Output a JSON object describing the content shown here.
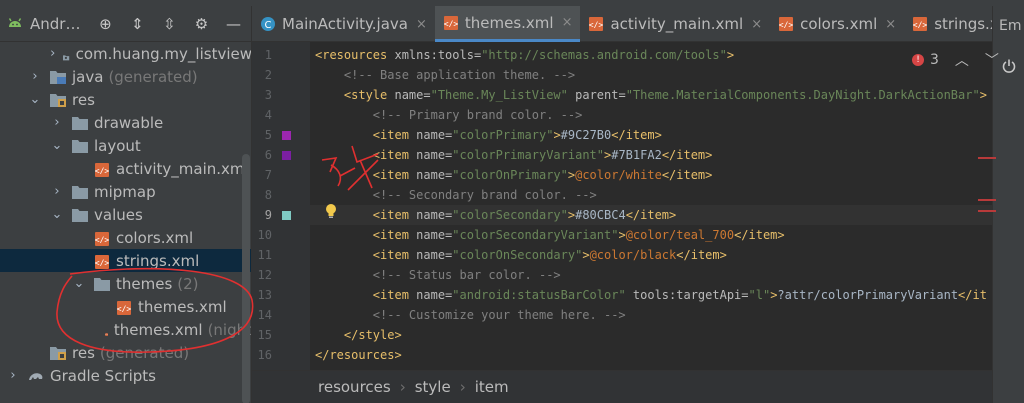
{
  "project_panel": {
    "title": "Andr…",
    "toolbar_icons": [
      "locate-icon",
      "collapse-icon",
      "expand-icon",
      "gear-icon",
      "minimize-icon"
    ]
  },
  "tree": [
    {
      "indent": 1,
      "arrow": "›",
      "icon": "folder-package",
      "label": "com.huang.my_listview",
      "suffix": "",
      "selected": false
    },
    {
      "indent": 0,
      "arrow": "›",
      "icon": "folder-java",
      "label": "java",
      "suffix": "(generated)",
      "selected": false
    },
    {
      "indent": 0,
      "arrow": "⌄",
      "icon": "folder-res",
      "label": "res",
      "suffix": "",
      "selected": false
    },
    {
      "indent": 1,
      "arrow": "›",
      "icon": "folder",
      "label": "drawable",
      "suffix": "",
      "selected": false
    },
    {
      "indent": 1,
      "arrow": "⌄",
      "icon": "folder",
      "label": "layout",
      "suffix": "",
      "selected": false
    },
    {
      "indent": 2,
      "arrow": "",
      "icon": "xml",
      "label": "activity_main.xml",
      "suffix": "",
      "selected": false
    },
    {
      "indent": 1,
      "arrow": "›",
      "icon": "folder",
      "label": "mipmap",
      "suffix": "",
      "selected": false
    },
    {
      "indent": 1,
      "arrow": "⌄",
      "icon": "folder",
      "label": "values",
      "suffix": "",
      "selected": false
    },
    {
      "indent": 2,
      "arrow": "",
      "icon": "xml",
      "label": "colors.xml",
      "suffix": "",
      "selected": false
    },
    {
      "indent": 2,
      "arrow": "",
      "icon": "xml",
      "label": "strings.xml",
      "suffix": "",
      "selected": true
    },
    {
      "indent": 2,
      "arrow": "⌄",
      "icon": "folder",
      "label": "themes",
      "suffix": "(2)",
      "selected": false
    },
    {
      "indent": 3,
      "arrow": "",
      "icon": "xml",
      "label": "themes.xml",
      "suffix": "",
      "selected": false
    },
    {
      "indent": 3,
      "arrow": "",
      "icon": "xml",
      "label": "themes.xml",
      "suffix": "(night",
      "selected": false
    },
    {
      "indent": 0,
      "arrow": "",
      "icon": "folder-res",
      "label": "res",
      "suffix": "(generated)",
      "selected": false
    },
    {
      "indent": -1,
      "arrow": "›",
      "icon": "gradle",
      "label": "Gradle Scripts",
      "suffix": "",
      "selected": false
    }
  ],
  "tabs": [
    {
      "label": "MainActivity.java",
      "icon": "java-class-icon",
      "active": false
    },
    {
      "label": "themes.xml",
      "icon": "xml-file-icon",
      "active": true
    },
    {
      "label": "activity_main.xml",
      "icon": "xml-file-icon",
      "active": false
    },
    {
      "label": "colors.xml",
      "icon": "xml-file-icon",
      "active": false
    },
    {
      "label": "strings.xml",
      "icon": "xml-file-icon",
      "active": false
    }
  ],
  "tab_close_glyph": "×",
  "right_strip": {
    "label": "Em"
  },
  "inspection": {
    "error_count": "3",
    "up": "︿",
    "down": "﹀"
  },
  "code_lines": [
    {
      "n": "1",
      "swatch": null,
      "html": "<span class='tag'>&lt;resources </span><span class='attr'>xmlns:tools=</span><span class='val'>\"http://schemas.android.com/tools\"</span><span class='tag'>&gt;</span>"
    },
    {
      "n": "2",
      "swatch": null,
      "html": "    <span class='cmt'>&lt;!-- Base application theme. --&gt;</span>"
    },
    {
      "n": "3",
      "swatch": null,
      "html": "    <span class='tag'>&lt;style </span><span class='attr'>name=</span><span class='val'>\"Theme.My_ListView\"</span><span class='attr'> parent=</span><span class='val'>\"Theme.MaterialComponents.DayNight.DarkActionBar\"</span><span class='tag'>&gt;</span>"
    },
    {
      "n": "4",
      "swatch": null,
      "html": "        <span class='cmt'>&lt;!-- Primary brand color. --&gt;</span>"
    },
    {
      "n": "5",
      "swatch": "#9C27B0",
      "html": "        <span class='tag'>&lt;item </span><span class='attr'>name=</span><span class='val'>\"colorPrimary\"</span><span class='tag'>&gt;</span><span class='txt'>#9C27B0</span><span class='tag'>&lt;/item&gt;</span>"
    },
    {
      "n": "6",
      "swatch": "#7B1FA2",
      "html": "        <span class='tag'>&lt;item </span><span class='attr'>name=</span><span class='val'>\"colorPrimaryVariant\"</span><span class='tag'>&gt;</span><span class='txt'>#7B1FA2</span><span class='tag'>&lt;/item&gt;</span>"
    },
    {
      "n": "7",
      "swatch": null,
      "html": "        <span class='tag'>&lt;item </span><span class='attr'>name=</span><span class='val'>\"colorOnPrimary\"</span><span class='tag'>&gt;</span><span class='ref'>@color/white</span><span class='tag'>&lt;/item&gt;</span>"
    },
    {
      "n": "8",
      "swatch": null,
      "html": "        <span class='cmt'>&lt;!-- Secondary brand color. --&gt;</span>"
    },
    {
      "n": "9",
      "swatch": "#80CBC4",
      "html": "        <span class='tag'>&lt;item </span><span class='attr'>name=</span><span class='val'>\"colorSecondary\"</span><span class='tag'>&gt;</span><span class='txt'>#80CBC4</span><span class='tag'>&lt;/item&gt;</span>"
    },
    {
      "n": "10",
      "swatch": null,
      "html": "        <span class='tag'>&lt;item </span><span class='attr'>name=</span><span class='val'>\"colorSecondaryVariant\"</span><span class='tag'>&gt;</span><span class='ref'>@color/teal_700</span><span class='tag'>&lt;/item&gt;</span>"
    },
    {
      "n": "11",
      "swatch": null,
      "html": "        <span class='tag'>&lt;item </span><span class='attr'>name=</span><span class='val'>\"colorOnSecondary\"</span><span class='tag'>&gt;</span><span class='ref'>@color/black</span><span class='tag'>&lt;/item&gt;</span>"
    },
    {
      "n": "12",
      "swatch": null,
      "html": "        <span class='cmt'>&lt;!-- Status bar color. --&gt;</span>"
    },
    {
      "n": "13",
      "swatch": null,
      "html": "        <span class='tag'>&lt;item </span><span class='attr'>name=</span><span class='val'>\"android:statusBarColor\"</span><span class='attr'> tools:targetApi=</span><span class='val'>\"l\"</span><span class='tag'>&gt;</span><span class='txt'>?attr/colorPrimaryVariant</span><span class='tag'>&lt;/it</span>"
    },
    {
      "n": "14",
      "swatch": null,
      "html": "        <span class='cmt'>&lt;!-- Customize your theme here. --&gt;</span>"
    },
    {
      "n": "15",
      "swatch": null,
      "html": "    <span class='tag'>&lt;/style&gt;</span>"
    },
    {
      "n": "16",
      "swatch": null,
      "html": "<span class='tag'>&lt;/resources&gt;</span>"
    }
  ],
  "current_line": "9",
  "breadcrumb": [
    "resources",
    "style",
    "item"
  ],
  "breadcrumb_sep": "›",
  "colors": {
    "accent": "#4a88c7",
    "error": "#d64545",
    "annotation": "#e03030"
  }
}
